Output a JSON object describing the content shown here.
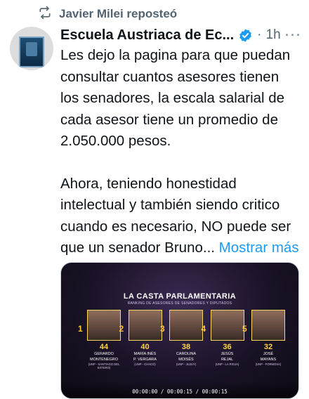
{
  "repost": {
    "text": "Javier Milei reposteó",
    "icon": "repost-icon"
  },
  "author": {
    "name": "Escuela Austriaca de Ec...",
    "separator": "·",
    "time": "1h",
    "more": "···",
    "verified_color": "#1d9bf0"
  },
  "tweet": {
    "paragraph1": "Les dejo la pagina para que puedan consultar cuantos asesores tienen los senadores, la escala salarial de cada asesor tiene un promedio de 2.050.000 pesos.",
    "paragraph2": "Ahora, teniendo honestidad intelectual y también siendo critico cuando es necesario, NO puede ser que un senador Bruno...",
    "show_more": "Mostrar más",
    "link_color": "#1d9bf0"
  },
  "media": {
    "title": "LA CASTA PARLAMENTARIA",
    "subtitle": "RANKING DE ASESORES DE SENADORES Y DIPUTADOS",
    "timecode": "00:00:00 / 00:00:15 / 00:00:15",
    "items": [
      {
        "rank": "1",
        "value": "44",
        "name_line1": "GERARDO",
        "name_line2": "MONTENEGRO",
        "place": "(UNP - SANTIAGO DEL ESTERO)"
      },
      {
        "rank": "2",
        "value": "40",
        "name_line1": "MARÍA INÉS",
        "name_line2": "P. VERGARA",
        "place": "(UNP - CHACO)"
      },
      {
        "rank": "3",
        "value": "38",
        "name_line1": "CAROLINA",
        "name_line2": "MOISÉS",
        "place": "(UNP - JUJUY)"
      },
      {
        "rank": "4",
        "value": "36",
        "name_line1": "JESÚS",
        "name_line2": "REJAL",
        "place": "(UNP - LA RIOJA)"
      },
      {
        "rank": "5",
        "value": "32",
        "name_line1": "JOSÉ",
        "name_line2": "MAYANS",
        "place": "(UNP - FORMOSA)"
      }
    ]
  }
}
